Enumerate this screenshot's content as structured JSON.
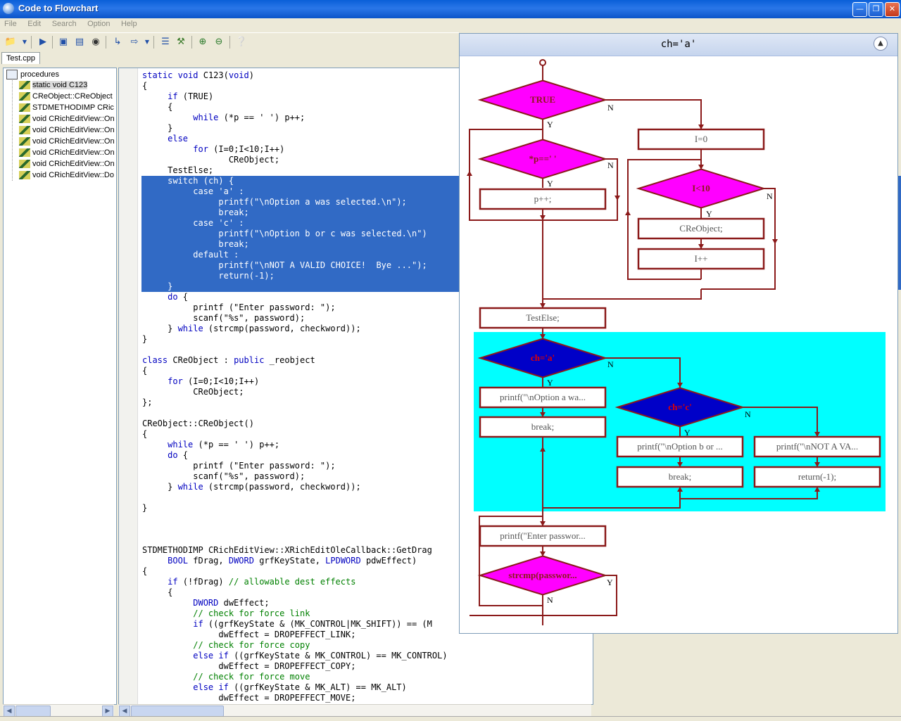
{
  "window": {
    "title": "Code to Flowchart"
  },
  "menu": [
    "File",
    "Edit",
    "Search",
    "Option",
    "Help"
  ],
  "tab": {
    "label": "Test.cpp"
  },
  "tree": {
    "root": "procedures",
    "items": [
      "static void C123",
      "CReObject::CReObject",
      "STDMETHODIMP CRic",
      "void CRichEditView::On",
      "void CRichEditView::On",
      "void CRichEditView::On",
      "void CRichEditView::On",
      "void CRichEditView::On",
      "void CRichEditView::Do"
    ]
  },
  "code": {
    "lines": [
      "static void C123(void)",
      "{",
      "     if (TRUE)",
      "     {",
      "          while (*p == ' ') p++;",
      "     }",
      "     else",
      "          for (I=0;I<10;I++)",
      "                 CReObject;",
      "     TestElse;",
      "     switch (ch) {",
      "          case 'a' :",
      "               printf(\"\\nOption a was selected.\\n\");",
      "               break;",
      "          case 'c' :",
      "               printf(\"\\nOption b or c was selected.\\n\")",
      "               break;",
      "          default :",
      "               printf(\"\\nNOT A VALID CHOICE!  Bye ...\");",
      "               return(-1);",
      "     }",
      "     do {",
      "          printf (\"Enter password: \");",
      "          scanf(\"%s\", password);",
      "     } while (strcmp(password, checkword));",
      "}",
      "",
      "class CReObject : public _reobject",
      "{",
      "     for (I=0;I<10;I++)",
      "          CReObject;",
      "};",
      "",
      "CReObject::CReObject()",
      "{",
      "     while (*p == ' ') p++;",
      "     do {",
      "          printf (\"Enter password: \");",
      "          scanf(\"%s\", password);",
      "     } while (strcmp(password, checkword));",
      "",
      "}",
      "",
      "",
      "",
      "STDMETHODIMP CRichEditView::XRichEditOleCallback::GetDrag",
      "     BOOL fDrag, DWORD grfKeyState, LPDWORD pdwEffect)",
      "{",
      "     if (!fDrag) // allowable dest effects",
      "     {",
      "          DWORD dwEffect;",
      "          // check for force link",
      "          if ((grfKeyState & (MK_CONTROL|MK_SHIFT)) == (M",
      "               dwEffect = DROPEFFECT_LINK;",
      "          // check for force copy",
      "          else if ((grfKeyState & MK_CONTROL) == MK_CONTROL)",
      "               dwEffect = DROPEFFECT_COPY;",
      "          // check for force move",
      "          else if ((grfKeyState & MK_ALT) == MK_ALT)",
      "               dwEffect = DROPEFFECT_MOVE;"
    ],
    "selected_range": [
      10,
      20
    ]
  },
  "flowchart": {
    "title": "ch='a'",
    "nodes": {
      "d_true": "TRUE",
      "d_p": "*p==' '",
      "b_pinc": "p++;",
      "b_i0": "I=0",
      "d_i10": "I<10",
      "b_creobj": "CReObject;",
      "b_iinc": "I++",
      "b_testelse": "TestElse;",
      "d_cha": "ch='a'",
      "b_printa": "printf(\"\\nOption a wa...",
      "b_break1": "break;",
      "d_chc": "ch='c'",
      "b_printb": "printf(\"\\nOption b or ...",
      "b_printnot": "printf(\"\\nNOT A VA...",
      "b_break2": "break;",
      "b_return": "return(-1);",
      "b_enterpw": "printf(\"Enter passwor...",
      "d_strcmp": "strcmp(passwor..."
    },
    "labels": {
      "yes": "Y",
      "no": "N"
    },
    "colors": {
      "line": "#8b1a1a",
      "decision": "#ff00ff",
      "decision_active": "#0000c8",
      "highlight": "#00ffff"
    }
  }
}
